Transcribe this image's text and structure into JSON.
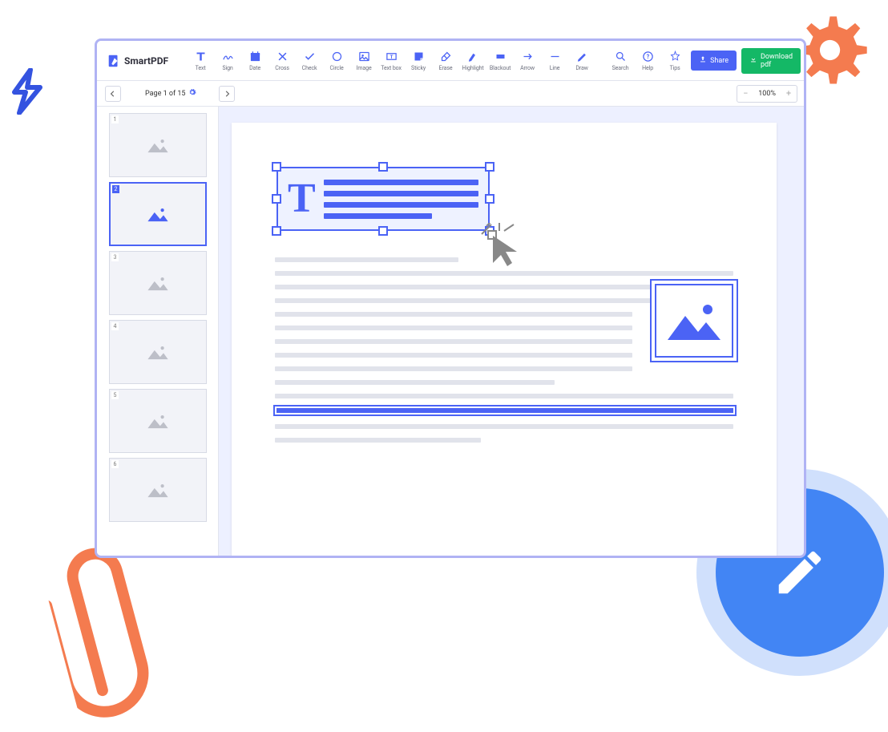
{
  "app": {
    "name": "SmartPDF"
  },
  "toolbar": {
    "tools": [
      {
        "label": "Text",
        "icon": "text"
      },
      {
        "label": "Sign",
        "icon": "sign"
      },
      {
        "label": "Date",
        "icon": "date"
      },
      {
        "label": "Cross",
        "icon": "cross"
      },
      {
        "label": "Check",
        "icon": "check"
      },
      {
        "label": "Circle",
        "icon": "circle"
      },
      {
        "label": "Image",
        "icon": "image"
      },
      {
        "label": "Text box",
        "icon": "textbox"
      },
      {
        "label": "Sticky",
        "icon": "sticky"
      },
      {
        "label": "Erase",
        "icon": "erase"
      },
      {
        "label": "Highlight",
        "icon": "highlight"
      },
      {
        "label": "Blackout",
        "icon": "blackout"
      },
      {
        "label": "Arrow",
        "icon": "arrow"
      },
      {
        "label": "Line",
        "icon": "line"
      },
      {
        "label": "Draw",
        "icon": "draw"
      }
    ],
    "help_tools": [
      {
        "label": "Search",
        "icon": "search"
      },
      {
        "label": "Help",
        "icon": "help"
      },
      {
        "label": "Tips",
        "icon": "tips"
      }
    ],
    "share": "Share",
    "download": "Download pdf"
  },
  "nav": {
    "page_label": "Page 1 of 15",
    "zoom": "100%"
  },
  "thumbs": {
    "total_pages": 6,
    "selected": 2
  },
  "textbox": {
    "letter": "T"
  }
}
